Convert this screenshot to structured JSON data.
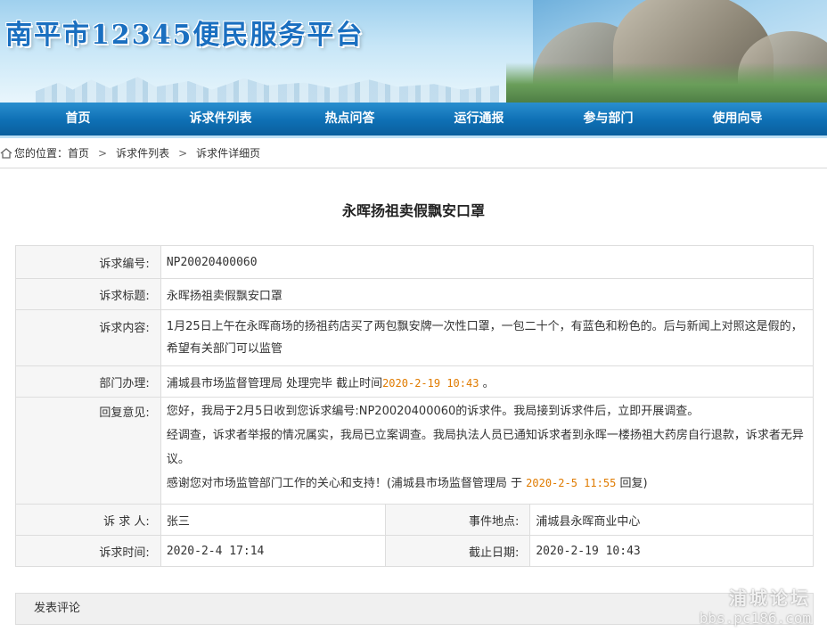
{
  "header": {
    "site_title": "南平市12345便民服务平台"
  },
  "nav": {
    "items": [
      "首页",
      "诉求件列表",
      "热点问答",
      "运行通报",
      "参与部门",
      "使用向导"
    ]
  },
  "breadcrumb": {
    "prefix": "您的位置：",
    "items": [
      "首页",
      "诉求件列表",
      "诉求件详细页"
    ]
  },
  "page": {
    "title": "永晖扬祖卖假飘安口罩"
  },
  "detail": {
    "id_label": "诉求编号:",
    "id_value": "NP20020400060",
    "subject_label": "诉求标题:",
    "subject_value": "永晖扬祖卖假飘安口罩",
    "content_label": "诉求内容:",
    "content_value": "1月25日上午在永晖商场的扬祖药店买了两包飘安牌一次性口罩，一包二十个，有蓝色和粉色的。后与新闻上对照这是假的，希望有关部门可以监管",
    "dept_label": "部门办理:",
    "dept_value": "浦城县市场监督管理局 处理完毕 截止时间",
    "dept_deadline": "2020-2-19 10:43",
    "dept_suffix": "。",
    "reply_label": "回复意见:",
    "reply_line1": "您好，我局于2月5日收到您诉求编号:NP20020400060的诉求件。我局接到诉求件后，立即开展调查。",
    "reply_line2": "经调查，诉求者举报的情况属实，我局已立案调查。我局执法人员已通知诉求者到永晖一楼扬祖大药房自行退款，诉求者无异议。",
    "reply_line3_prefix": "感谢您对市场监管部门工作的关心和支持！(浦城县市场监督管理局 于 ",
    "reply_time": "2020-2-5 11:55",
    "reply_line3_suffix": " 回复)",
    "petitioner_label": "诉 求 人:",
    "petitioner_value": "张三",
    "location_label": "事件地点:",
    "location_value": "浦城县永晖商业中心",
    "time_label": "诉求时间:",
    "time_value": "2020-2-4 17:14",
    "deadline_label": "截止日期:",
    "deadline_value": "2020-2-19 10:43"
  },
  "comment": {
    "label": "发表评论"
  },
  "watermark": {
    "line1": "浦城论坛",
    "line2": "bbs.pc186.com"
  }
}
